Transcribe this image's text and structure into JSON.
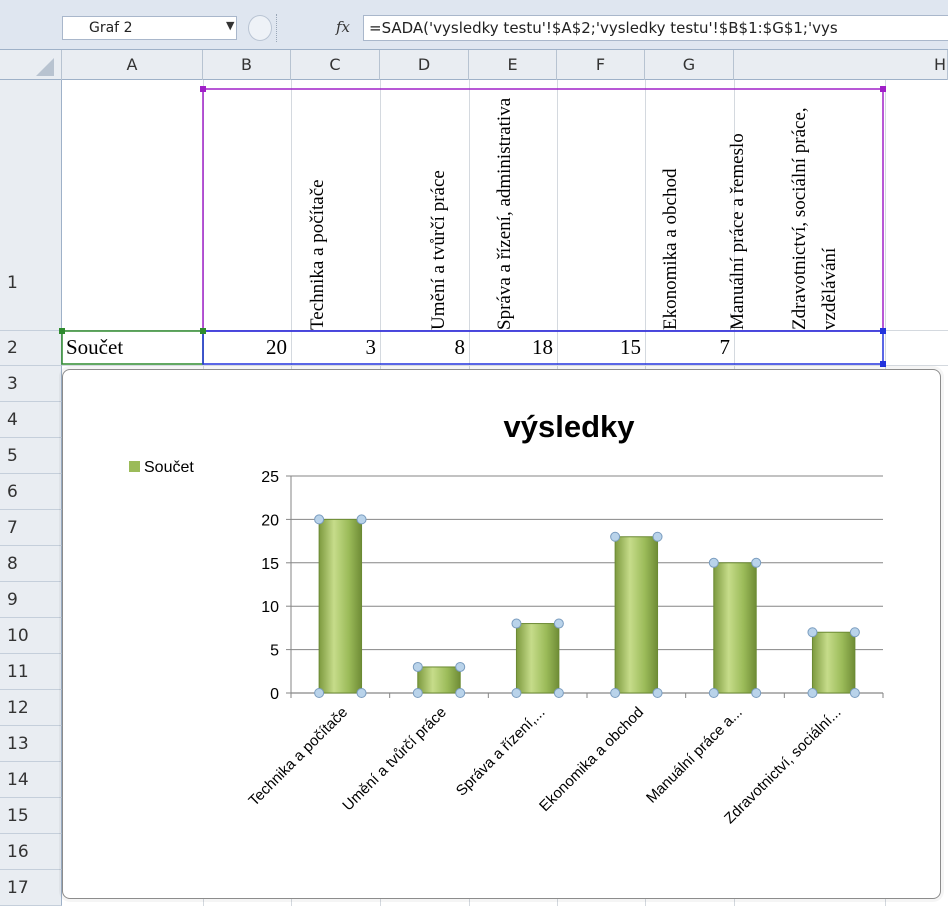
{
  "formula_bar": {
    "name_box": "Graf 2",
    "fx_label": "fx",
    "formula": "=SADA('vysledky testu'!$A$2;'vysledky testu'!$B$1:$G$1;'vys"
  },
  "columns": [
    "A",
    "B",
    "C",
    "D",
    "E",
    "F",
    "G",
    "H"
  ],
  "rows": [
    "1",
    "2",
    "3",
    "4",
    "5",
    "6",
    "7",
    "8",
    "9",
    "10",
    "11",
    "12",
    "13",
    "14",
    "15",
    "16",
    "17"
  ],
  "sheet": {
    "headers": [
      "Technika a počítače",
      "Umění a tvůrčí práce",
      "Správa a řízení, administrativa",
      "Ekonomika a obchod",
      "Manuální práce a řemeslo",
      "Zdravotnictví, sociální práce, vzdělávání"
    ],
    "row_label": "Součet",
    "values": [
      "20",
      "3",
      "8",
      "18",
      "15",
      "7"
    ]
  },
  "colors": {
    "bar_fill": "#9bbb59",
    "bar_highlight": "#c6dc8a",
    "handle": "#b9d3ea",
    "grid": "#868686"
  },
  "chart_data": {
    "type": "bar",
    "title": "výsledky",
    "categories": [
      "Technika a počítače",
      "Umění a tvůrčí práce",
      "Správa a řízení,...",
      "Ekonomika a obchod",
      "Manuální práce a...",
      "Zdravotnictví, sociální..."
    ],
    "series": [
      {
        "name": "Součet",
        "values": [
          20,
          3,
          8,
          18,
          15,
          7
        ]
      }
    ],
    "ylim": [
      0,
      25
    ],
    "yticks": [
      0,
      5,
      10,
      15,
      20,
      25
    ],
    "legend": "left",
    "grid": true,
    "selected": true
  }
}
